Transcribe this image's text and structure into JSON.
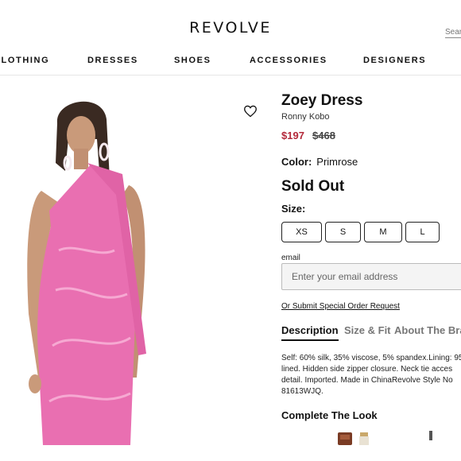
{
  "header": {
    "logo": "REVOLVE",
    "search_placeholder": "Search"
  },
  "nav": {
    "items": [
      {
        "label": "CLOTHING"
      },
      {
        "label": "DRESSES"
      },
      {
        "label": "SHOES"
      },
      {
        "label": "ACCESSORIES"
      },
      {
        "label": "DESIGNERS"
      }
    ]
  },
  "product": {
    "name": "Zoey Dress",
    "brand": "Ronny Kobo",
    "sale_price": "$197",
    "original_price": "$468",
    "color_label": "Color:",
    "color_value": "Primrose",
    "availability": "Sold Out",
    "size_label": "Size:",
    "sizes": [
      "XS",
      "S",
      "M",
      "L"
    ],
    "image_colors": {
      "dress": "#e96fb1",
      "skin": "#c99a7a",
      "hair": "#3a2a22"
    }
  },
  "notify": {
    "email_label": "email",
    "email_placeholder": "Enter your email address",
    "special_order_link": "Or Submit Special Order Request"
  },
  "tabs": [
    {
      "label": "Description",
      "active": true
    },
    {
      "label": "Size & Fit",
      "active": false
    },
    {
      "label": "About The Brand",
      "active": false
    }
  ],
  "description_lines": [
    "Self: 60% silk, 35% viscose, 5% spandex.Lining: 95",
    "lined. Hidden side zipper closure. Neck tie acces",
    "detail. Imported. Made in ChinaRevolve Style No",
    "81613WJQ."
  ],
  "complete_the_look": {
    "title": "Complete The Look"
  }
}
